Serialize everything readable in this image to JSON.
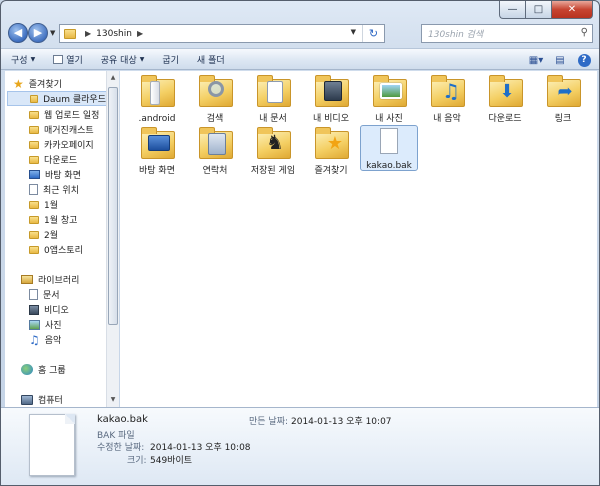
{
  "address": {
    "path_segments": [
      "130shin"
    ],
    "search_placeholder": "130shin 검색"
  },
  "toolbar": {
    "organize": "구성",
    "open": "열기",
    "share_with": "공유 대상",
    "burn": "굽기",
    "new_folder": "새 폴더"
  },
  "nav": {
    "favorites_header": "즐겨찾기",
    "favorites": [
      "Daum 클라우드",
      "웹 업로드 일정",
      "매거진캐스트",
      "카카오페이지",
      "다운로드",
      "바탕 화면",
      "최근 위치",
      "1월",
      "1월 창고",
      "2월",
      "0앱스토리"
    ],
    "libraries_header": "라이브러리",
    "libraries": [
      "문서",
      "비디오",
      "사진",
      "음악"
    ],
    "homegroup": "홈 그룹",
    "computer": "컴퓨터"
  },
  "files": [
    {
      "name": ".android",
      "icon": "folder-icon"
    },
    {
      "name": "검색",
      "icon": "search-folder-icon"
    },
    {
      "name": "내 문서",
      "icon": "documents-folder-icon"
    },
    {
      "name": "내 비디오",
      "icon": "videos-folder-icon"
    },
    {
      "name": "내 사진",
      "icon": "pictures-folder-icon"
    },
    {
      "name": "내 음악",
      "icon": "music-folder-icon"
    },
    {
      "name": "다운로드",
      "icon": "downloads-folder-icon"
    },
    {
      "name": "링크",
      "icon": "links-folder-icon"
    },
    {
      "name": "바탕 화면",
      "icon": "desktop-folder-icon"
    },
    {
      "name": "연락처",
      "icon": "contacts-folder-icon"
    },
    {
      "name": "저장된 게임",
      "icon": "saved-games-folder-icon"
    },
    {
      "name": "즐겨찾기",
      "icon": "favorites-folder-icon"
    },
    {
      "name": "kakao.bak",
      "icon": "file-icon"
    }
  ],
  "details": {
    "filename": "kakao.bak",
    "type": "BAK 파일",
    "date_created_label": "만든 날짜:",
    "date_created": "2014-01-13 오후 10:07",
    "date_modified_label": "수정한 날짜:",
    "date_modified": "2014-01-13 오후 10:08",
    "size_label": "크기:",
    "size": "549바이트"
  }
}
